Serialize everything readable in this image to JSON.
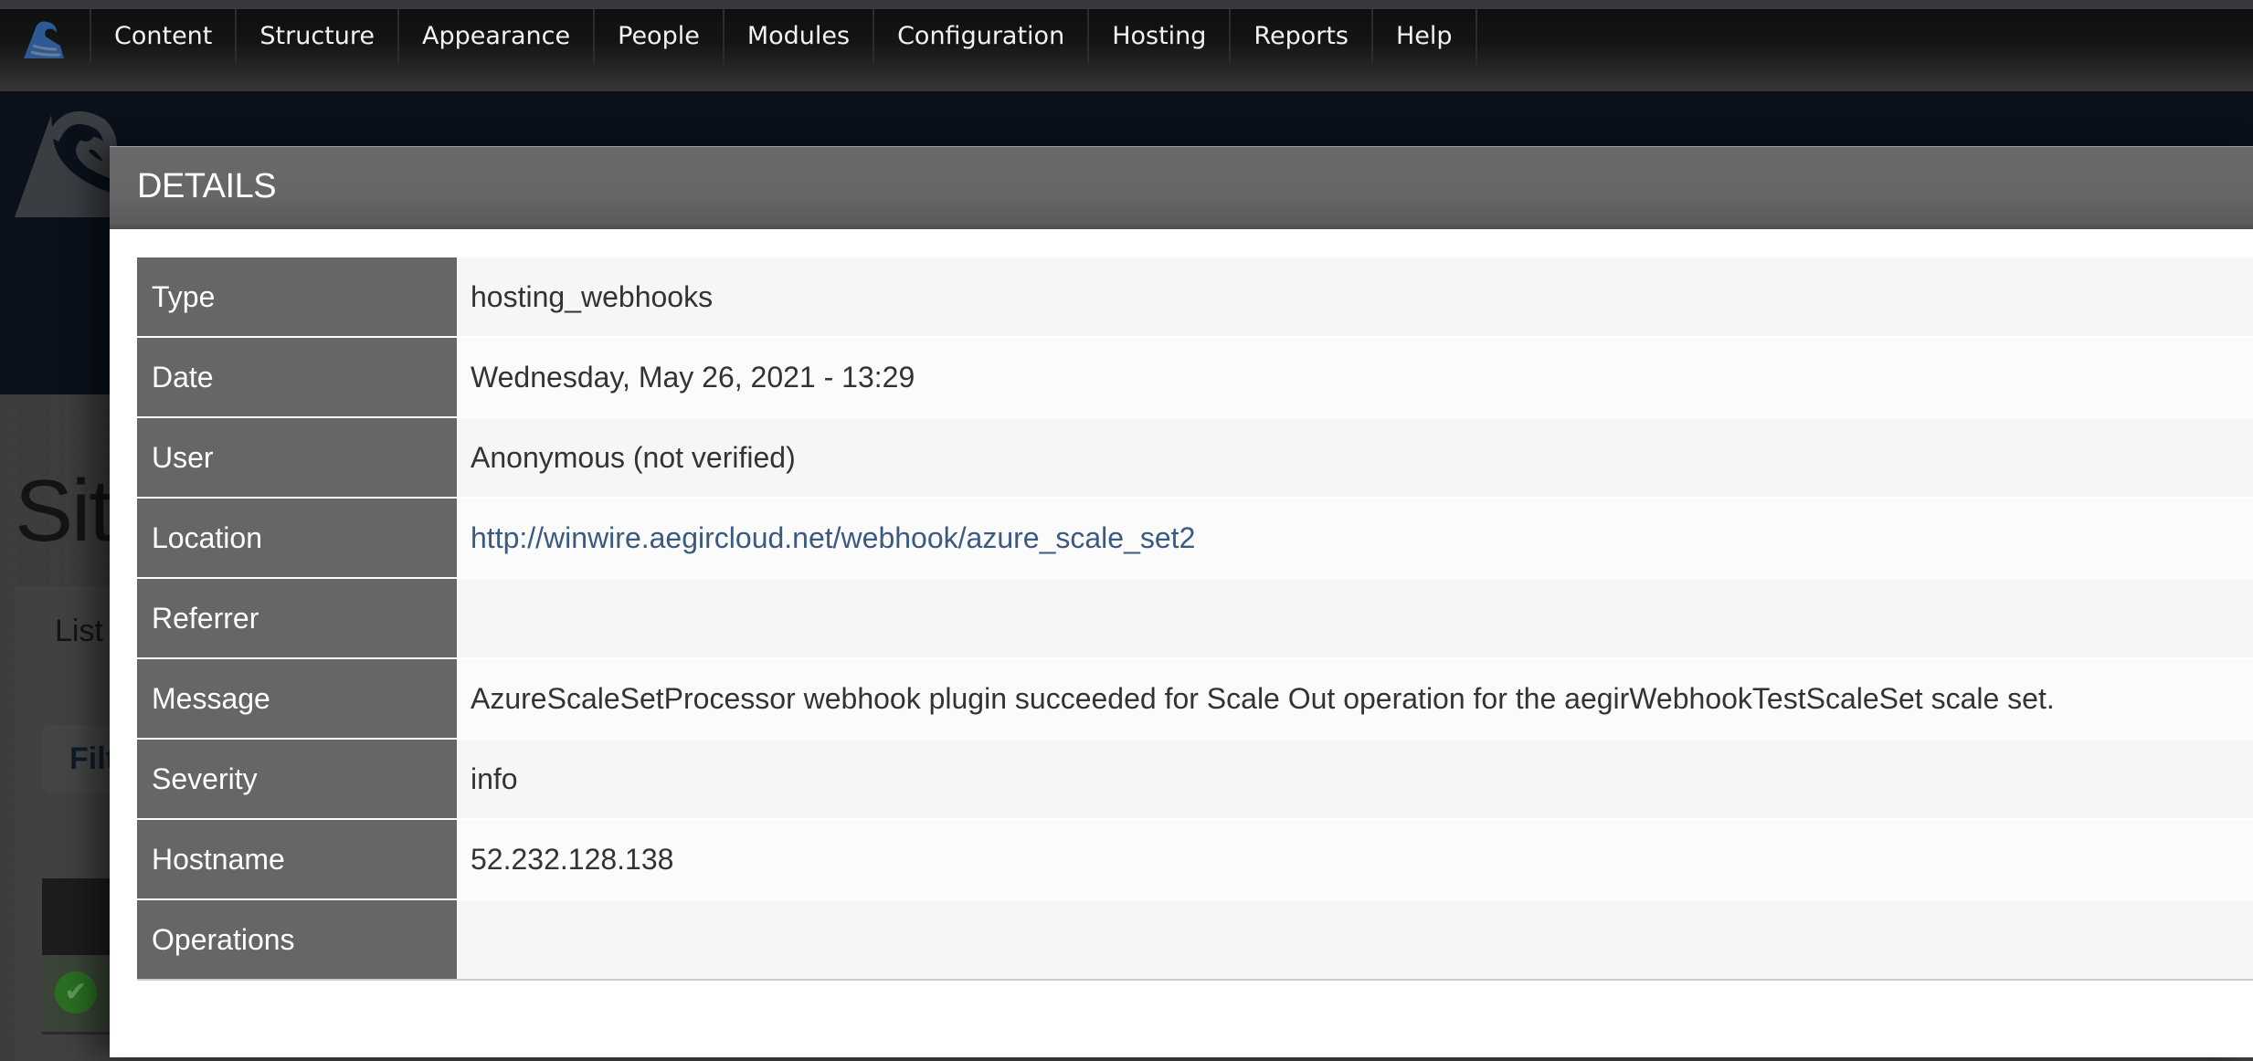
{
  "toolbar": {
    "logo_icon": "aegir-wave-logo-icon",
    "items": [
      {
        "label": "Content"
      },
      {
        "label": "Structure"
      },
      {
        "label": "Appearance"
      },
      {
        "label": "People"
      },
      {
        "label": "Modules"
      },
      {
        "label": "Configuration"
      },
      {
        "label": "Hosting"
      },
      {
        "label": "Reports"
      },
      {
        "label": "Help"
      }
    ]
  },
  "background_page": {
    "title": "Site",
    "tab_label": "List",
    "filter_label": "Filt",
    "status_icon": "check-circle-icon"
  },
  "modal": {
    "title": "DETAILS",
    "rows": [
      {
        "label": "Type",
        "value": "hosting_webhooks"
      },
      {
        "label": "Date",
        "value": "Wednesday, May 26, 2021 - 13:29"
      },
      {
        "label": "User",
        "value": "Anonymous (not verified)"
      },
      {
        "label": "Location",
        "value": "http://winwire.aegircloud.net/webhook/azure_scale_set2"
      },
      {
        "label": "Referrer",
        "value": ""
      },
      {
        "label": "Message",
        "value": "AzureScaleSetProcessor webhook plugin succeeded for Scale Out operation for the aegirWebhookTestScaleSet scale set."
      },
      {
        "label": "Severity",
        "value": "info"
      },
      {
        "label": "Hostname",
        "value": "52.232.128.138"
      },
      {
        "label": "Operations",
        "value": ""
      }
    ]
  },
  "colors": {
    "toolbar_bg": "#111111",
    "header_navy": "#0a111b",
    "modal_header": "#666666",
    "label_cell": "#666666",
    "link": "#3b5a80",
    "value_text": "#333333"
  }
}
